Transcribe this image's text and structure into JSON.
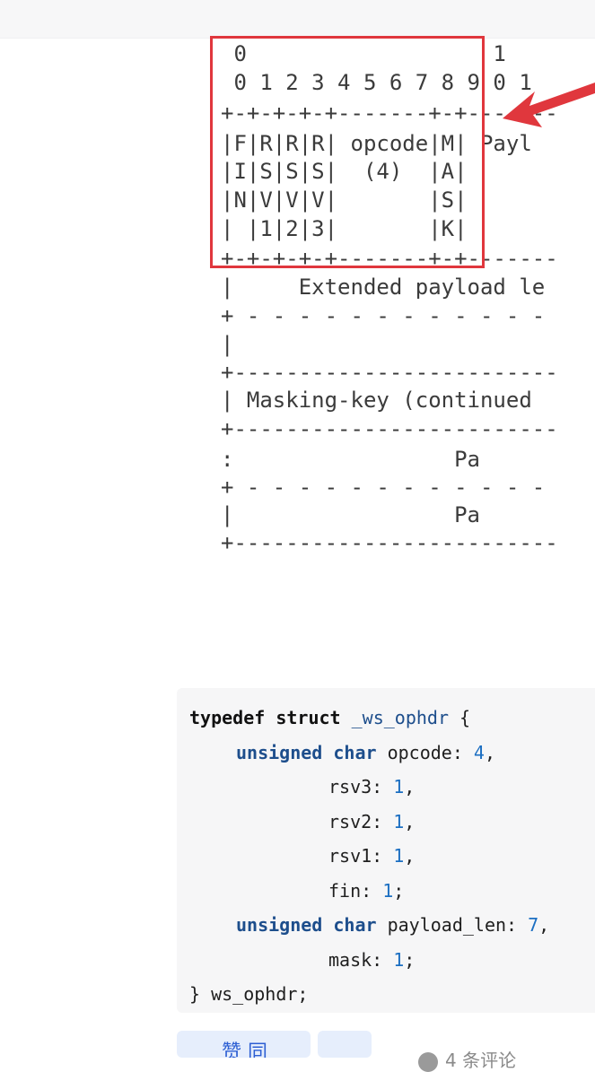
{
  "frame_figure": {
    "lines": [
      " 0                   1",
      " 0 1 2 3 4 5 6 7 8 9 0 1",
      "+-+-+-+-+-------+-+-------",
      "|F|R|R|R| opcode|M| Payl",
      "|I|S|S|S|  (4)  |A|",
      "|N|V|V|V|       |S|",
      "| |1|2|3|       |K|",
      "+-+-+-+-+-------+-+-------",
      "|     Extended payload le",
      "+ - - - - - - - - - - - -",
      "|",
      "+-------------------------",
      "| Masking-key (continued",
      "+-------------------------",
      ":                 Pa",
      "+ - - - - - - - - - - - -",
      "|                 Pa",
      "+-------------------------"
    ],
    "highlight_color": "#e0373d"
  },
  "code": {
    "line1": {
      "kw": "typedef struct",
      "name": "_ws_ophdr",
      "rest": " {"
    },
    "line2": {
      "type": "unsigned char",
      "field": " opcode: ",
      "num": "4",
      "end": ","
    },
    "line3": {
      "field": "rsv3: ",
      "num": "1",
      "end": ","
    },
    "line4": {
      "field": "rsv2: ",
      "num": "1",
      "end": ","
    },
    "line5": {
      "field": "rsv1: ",
      "num": "1",
      "end": ","
    },
    "line6": {
      "field": "fin: ",
      "num": "1",
      "end": ";"
    },
    "line7": {
      "type": "unsigned char",
      "field": " payload_len: ",
      "num": "7",
      "end": ","
    },
    "line8": {
      "field": "mask: ",
      "num": "1",
      "end": ";"
    },
    "line9": {
      "text": "} ws_ophdr;"
    }
  },
  "bottom": {
    "button1_label": "赞 同",
    "meta_text": "4 条评论"
  }
}
